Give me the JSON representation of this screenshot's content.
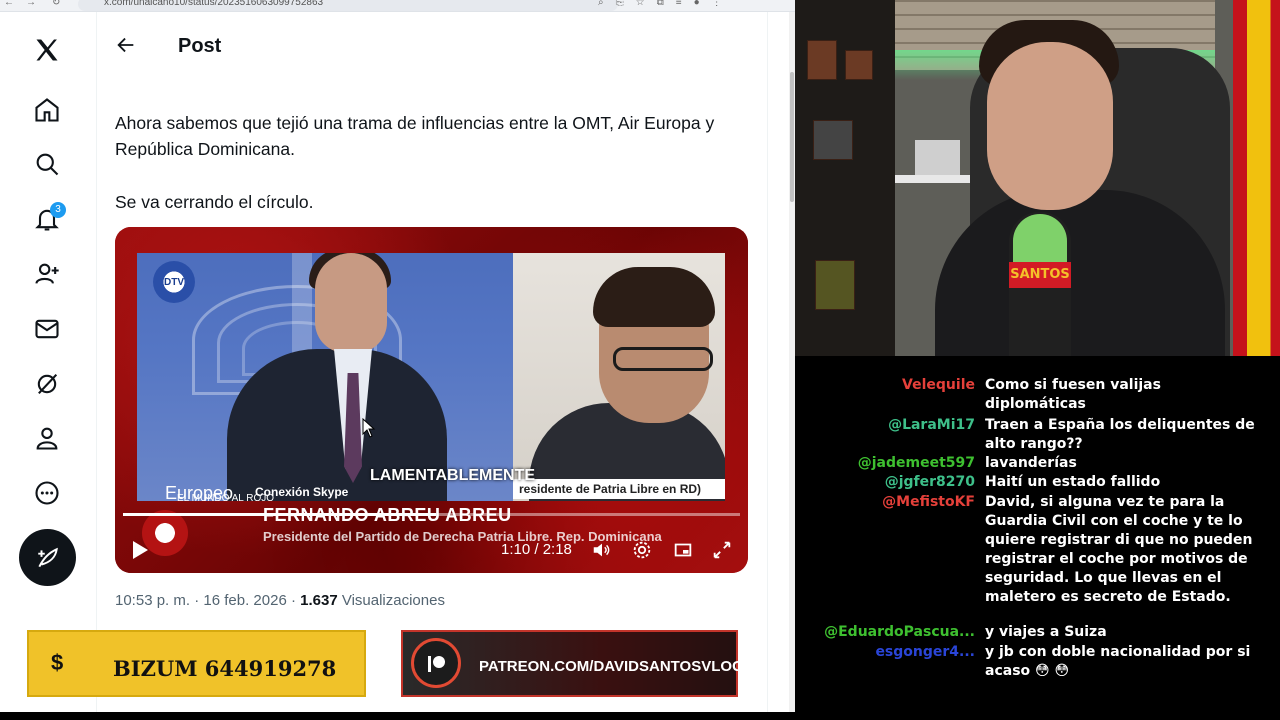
{
  "browser": {
    "url": "x.com/unaicano10/status/2023516063099752863"
  },
  "nav": {
    "notifications_badge": "3"
  },
  "post": {
    "header_title": "Post",
    "paragraph1": "Ahora sabemos que tejió una trama de influencias entre la OMT, Air Europa y República Dominicana.",
    "paragraph2": "Se va cerrando el círculo.",
    "meta_time": "10:53 p. m. · 16 feb. 2026 · ",
    "meta_views": "1.637",
    "meta_views_label": " Visualizaciones"
  },
  "video": {
    "dtv_logo": "DTV",
    "europeo_text": "Europeo",
    "lament_caption": "LAMENTABLEMENTE",
    "patria_caption": "residente de Patria Libre en RD)",
    "skype_tag": "Conexión Skype",
    "show_name": "EL MUNDO AL ROJO",
    "guest_name": "FERNANDO ABREU ABREU",
    "guest_role": "Presidente del Partido de Derecha Patria Libre. Rep. Dominicana",
    "time": "1:10 / 2:18",
    "progress": 0.507
  },
  "banners": {
    "bizum_symbol": "$",
    "bizum_text": "BIZUM 644919278",
    "patreon_text": "PATREON.COM/DAVIDSANTOSVLOG"
  },
  "webcam": {
    "mic_brand": "SANTOS"
  },
  "chat": {
    "messages": [
      {
        "user": "Velequile",
        "text": "Como si fuesen valijas diplomáticas",
        "color": "#e5403a"
      },
      {
        "user": "@LaraMi17",
        "text": "Traen a España los deliquentes de alto rango??",
        "color": "#3ec08a"
      },
      {
        "user": "@jademeet597",
        "text": "lavanderías",
        "color": "#3ec030"
      },
      {
        "user": "@jgfer8270",
        "text": "Haití un estado fallido",
        "color": "#3ec08a"
      },
      {
        "user": "@MefistoKF",
        "text": "David, si alguna vez te para la Guardia Civil con el coche y te lo quiere registrar di que no pueden registrar el coche por motivos de seguridad. Lo que llevas en el maletero es secreto de Estado.",
        "color": "#e5403a"
      },
      {
        "user": "@EduardoPascua...",
        "text": "y viajes a Suiza",
        "color": "#3ec030"
      },
      {
        "user": "esgonger4...",
        "text": "y jb con doble nacionalidad por si acaso 😳 😳",
        "color": "#2a45d8"
      }
    ]
  }
}
